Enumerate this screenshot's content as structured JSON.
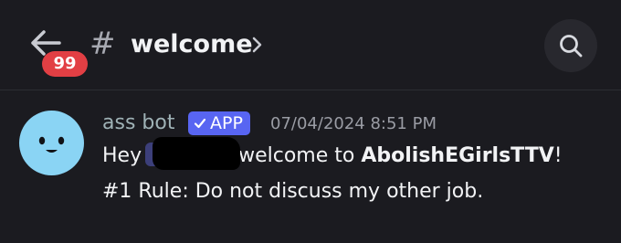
{
  "header": {
    "unread_badge": "99",
    "channel_hash": "#",
    "channel_name": "welcome",
    "icons": [
      "back-arrow-icon",
      "chevron-right-icon",
      "search-icon"
    ]
  },
  "message": {
    "author": "ass bot",
    "app_tag": "APP",
    "app_tag_icon": "checkmark-icon",
    "timestamp": "07/04/2024 8:51 PM",
    "line1_prefix": "Hey",
    "line1_after_mention": "welcome to ",
    "server_name": "AbolishEGirlsTTV",
    "line1_suffix": "!",
    "line2": "#1 Rule: Do not discuss my other job.",
    "avatar_icon": "bot-face-icon"
  },
  "colors": {
    "background": "#1b1b20",
    "badge": "#e23f44",
    "app_tag": "#5865f2",
    "avatar": "#8ad4f4",
    "mention": "#3c3f7a"
  }
}
